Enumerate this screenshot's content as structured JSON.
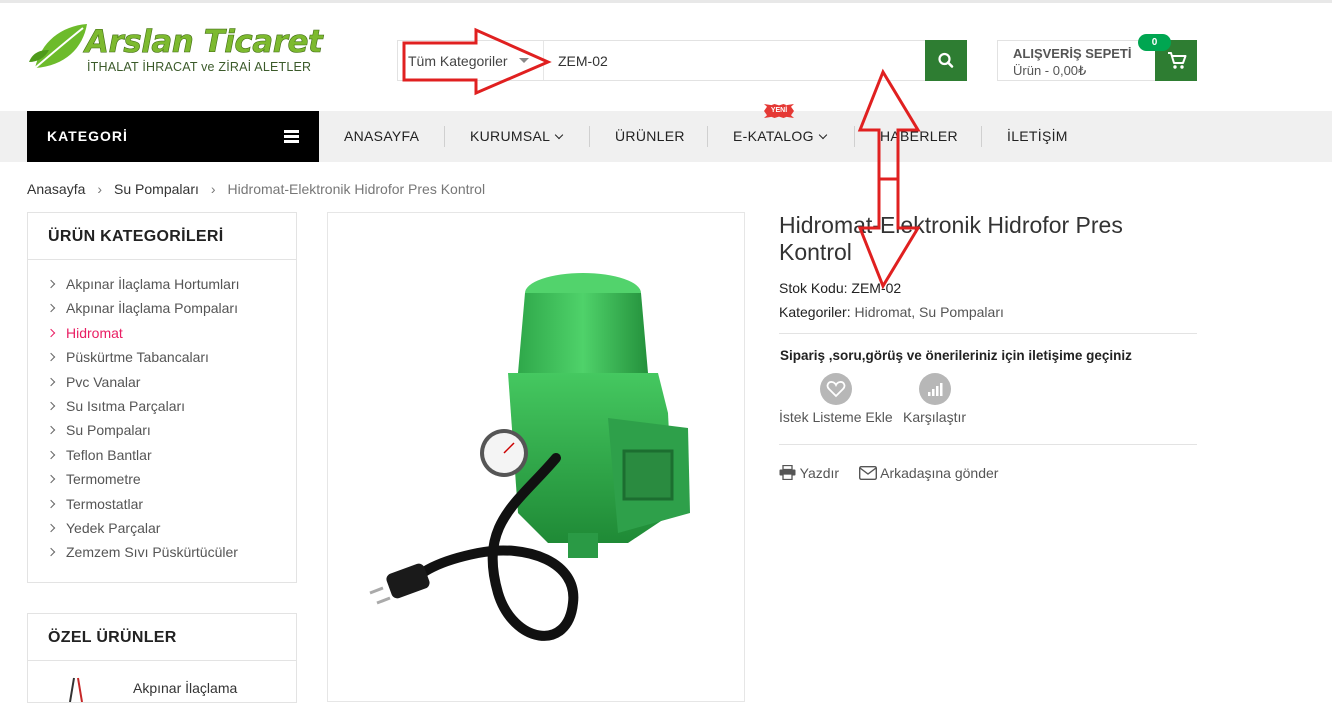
{
  "logo": {
    "title": "Arslan Ticaret",
    "subtitle": "İTHALAT İHRACAT ve ZİRAİ ALETLER"
  },
  "search": {
    "category": "Tüm Kategoriler",
    "query": "ZEM-02",
    "button_icon": "search-icon"
  },
  "cart": {
    "title": "ALIŞVERİŞ SEPETİ",
    "summary": "Ürün - 0,00₺",
    "count": "0",
    "icon": "cart-icon"
  },
  "nav": {
    "category_button": "KATEGORİ",
    "items": [
      "ANASAYFA",
      "KURUMSAL",
      "ÜRÜNLER",
      "E-KATALOG",
      "HABERLER",
      "İLETİŞİM"
    ],
    "new_badge": "YENİ"
  },
  "breadcrumb": {
    "items": [
      "Anasayfa",
      "Su Pompaları"
    ],
    "current": "Hidromat-Elektronik Hidrofor Pres Kontrol"
  },
  "sidebar": {
    "categories_title": "ÜRÜN KATEGORİLERİ",
    "categories": [
      "Akpınar İlaçlama Hortumları",
      "Akpınar İlaçlama Pompaları",
      "Hidromat",
      "Püskürtme Tabancaları",
      "Pvc Vanalar",
      "Su Isıtma Parçaları",
      "Su Pompaları",
      "Teflon Bantlar",
      "Termometre",
      "Termostatlar",
      "Yedek Parçalar",
      "Zemzem Sıvı Püskürtücüler"
    ],
    "active_category": "Hidromat",
    "special_title": "ÖZEL ÜRÜNLER",
    "special_item": "Akpınar İlaçlama"
  },
  "product": {
    "title": "Hidromat-Elektronik Hidrofor Pres Kontrol",
    "stock_label": "Stok Kodu:",
    "stock_code": "ZEM-02",
    "categories_label": "Kategoriler:",
    "categories": "Hidromat, Su Pompaları",
    "notice": "Sipariş ,soru,görüş ve önerileriniz için iletişime geçiniz",
    "wishlist": "İstek Listeme Ekle",
    "compare": "Karşılaştır",
    "print": "Yazdır",
    "send_friend": "Arkadaşına gönder"
  },
  "colors": {
    "green": "#2e7d32",
    "accent": "#e91e63",
    "annotation": "#e02020"
  }
}
